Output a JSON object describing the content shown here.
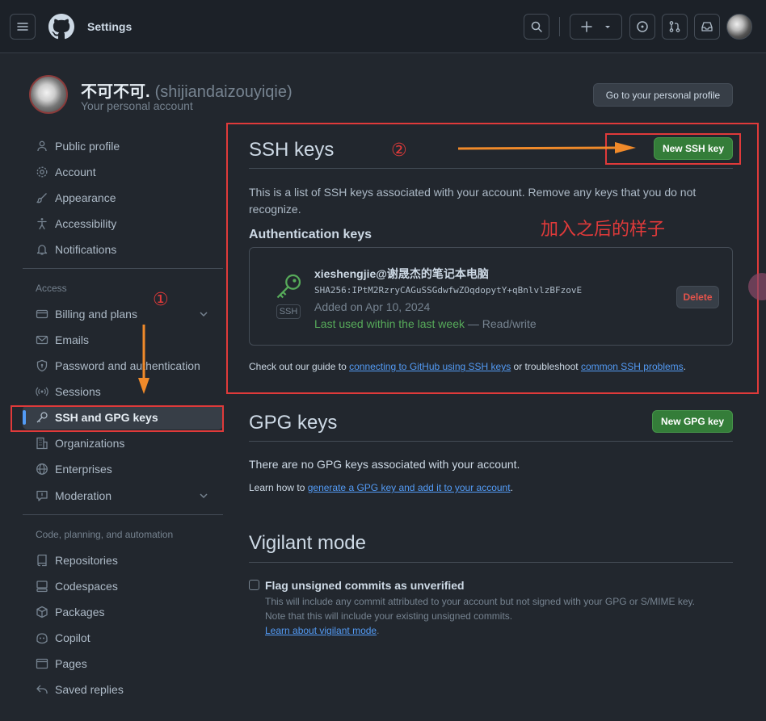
{
  "header": {
    "title": "Settings",
    "icons": [
      "menu-icon",
      "github-logo",
      "search-icon",
      "plus-icon",
      "triangle-down-icon",
      "issues-icon",
      "pull-request-icon",
      "inbox-icon"
    ]
  },
  "profile": {
    "name": "不可不可.",
    "login": "(shijiandaizouyiqie)",
    "subtitle": "Your personal account",
    "go_profile_button": "Go to your personal profile"
  },
  "sidebar": {
    "items_top": [
      {
        "label": "Public profile",
        "icon": "person-icon"
      },
      {
        "label": "Account",
        "icon": "gear-icon"
      },
      {
        "label": "Appearance",
        "icon": "paintbrush-icon"
      },
      {
        "label": "Accessibility",
        "icon": "accessibility-icon"
      },
      {
        "label": "Notifications",
        "icon": "bell-icon"
      }
    ],
    "group_access": "Access",
    "items_access": [
      {
        "label": "Billing and plans",
        "icon": "credit-card-icon"
      },
      {
        "label": "Emails",
        "icon": "mail-icon"
      },
      {
        "label": "Password and authentication",
        "icon": "shield-lock-icon"
      },
      {
        "label": "Sessions",
        "icon": "broadcast-icon"
      },
      {
        "label": "SSH and GPG keys",
        "icon": "key-icon"
      },
      {
        "label": "Organizations",
        "icon": "organization-icon"
      },
      {
        "label": "Enterprises",
        "icon": "globe-icon"
      },
      {
        "label": "Moderation",
        "icon": "report-icon"
      }
    ],
    "group_code": "Code, planning, and automation",
    "items_code": [
      {
        "label": "Repositories",
        "icon": "repo-icon"
      },
      {
        "label": "Codespaces",
        "icon": "codespaces-icon"
      },
      {
        "label": "Packages",
        "icon": "package-icon"
      },
      {
        "label": "Copilot",
        "icon": "copilot-icon"
      },
      {
        "label": "Pages",
        "icon": "browser-icon"
      },
      {
        "label": "Saved replies",
        "icon": "reply-icon"
      }
    ]
  },
  "ssh": {
    "title": "SSH keys",
    "new_button": "New SSH key",
    "description": "This is a list of SSH keys associated with your account. Remove any keys that you do not recognize.",
    "auth_heading": "Authentication keys",
    "key": {
      "name": "xieshengjie@谢晟杰的笔记本电脑",
      "fingerprint": "SHA256:IPtM2RzryCAGuSSGdwfwZOqdopytY+qBnlvlzBFzovE",
      "added": "Added on Apr 10, 2024",
      "last_used": "Last used within the last week",
      "access": "— Read/write",
      "badge": "SSH",
      "delete_button": "Delete"
    },
    "guide_prefix": "Check out our guide to",
    "guide_link1": "connecting to GitHub using SSH keys",
    "guide_middle": "or troubleshoot",
    "guide_link2": "common SSH problems",
    "guide_suffix": "."
  },
  "gpg": {
    "title": "GPG keys",
    "new_button": "New GPG key",
    "empty_text": "There are no GPG keys associated with your account.",
    "learn_prefix": "Learn how to",
    "learn_link": "generate a GPG key and add it to your account",
    "learn_suffix": "."
  },
  "vigilant": {
    "title": "Vigilant mode",
    "checkbox_label": "Flag unsigned commits as unverified",
    "note1": "This will include any commit attributed to your account but not signed with your GPG or S/MIME key.",
    "note2": "Note that this will include your existing unsigned commits.",
    "learn_link": "Learn about vigilant mode",
    "learn_suffix": "."
  },
  "annotations": {
    "step1": "①",
    "step2": "②",
    "note": "加入之后的样子"
  },
  "colors": {
    "background": "#22272e",
    "header": "#1c2128",
    "accent_blue": "#539bf5",
    "green_button": "#347d39",
    "annotation_red": "#e03a3a",
    "arrow_orange": "#f08a2a",
    "success_green": "#57ab5a"
  }
}
